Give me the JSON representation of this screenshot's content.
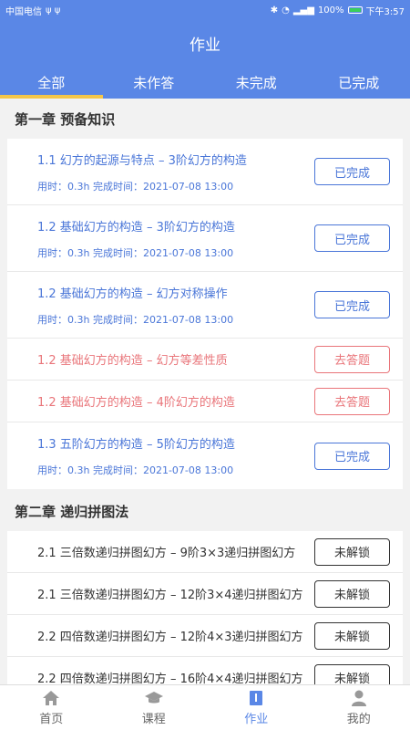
{
  "status": {
    "carrier": "中国电信",
    "battery": "100%",
    "time": "下午3:57"
  },
  "header": {
    "title": "作业"
  },
  "tabs": [
    {
      "label": "全部",
      "active": true
    },
    {
      "label": "未作答",
      "active": false
    },
    {
      "label": "未完成",
      "active": false
    },
    {
      "label": "已完成",
      "active": false
    }
  ],
  "chapters": [
    {
      "title": "第一章  预备知识",
      "items": [
        {
          "title": "1.1 幻方的起源与特点 – 3阶幻方的构造",
          "meta": "用时：0.3h  完成时间：2021-07-08 13:00",
          "button": "已完成"
        },
        {
          "title": "1.2 基础幻方的构造 – 3阶幻方的构造",
          "meta": "用时：0.3h  完成时间：2021-07-08 13:00",
          "button": "已完成"
        },
        {
          "title": "1.2 基础幻方的构造 – 幻方对称操作",
          "meta": "用时：0.3h  完成时间：2021-07-08 13:00",
          "button": "已完成"
        },
        {
          "title": "1.2 基础幻方的构造 – 幻方等差性质",
          "button": "去答题"
        },
        {
          "title": "1.2 基础幻方的构造 – 4阶幻方的构造",
          "button": "去答题"
        },
        {
          "title": "1.3 五阶幻方的构造 – 5阶幻方的构造",
          "meta": "用时：0.3h  完成时间：2021-07-08 13:00",
          "button": "已完成"
        }
      ]
    },
    {
      "title": "第二章  递归拼图法",
      "items": [
        {
          "title": "2.1 三倍数递归拼图幻方 – 9阶3×3递归拼图幻方",
          "button": "未解锁"
        },
        {
          "title": "2.1 三倍数递归拼图幻方 – 12阶3×4递归拼图幻方",
          "button": "未解锁"
        },
        {
          "title": "2.2 四倍数递归拼图幻方 – 12阶4×3递归拼图幻方",
          "button": "未解锁"
        },
        {
          "title": "2.2 四倍数递归拼图幻方 – 16阶4×4递归拼图幻方",
          "button": "未解锁"
        }
      ]
    }
  ],
  "nav": [
    {
      "label": "首页",
      "icon": "home-icon"
    },
    {
      "label": "课程",
      "icon": "graduation-cap-icon"
    },
    {
      "label": "作业",
      "icon": "book-icon",
      "active": true
    },
    {
      "label": "我的",
      "icon": "user-icon"
    }
  ]
}
